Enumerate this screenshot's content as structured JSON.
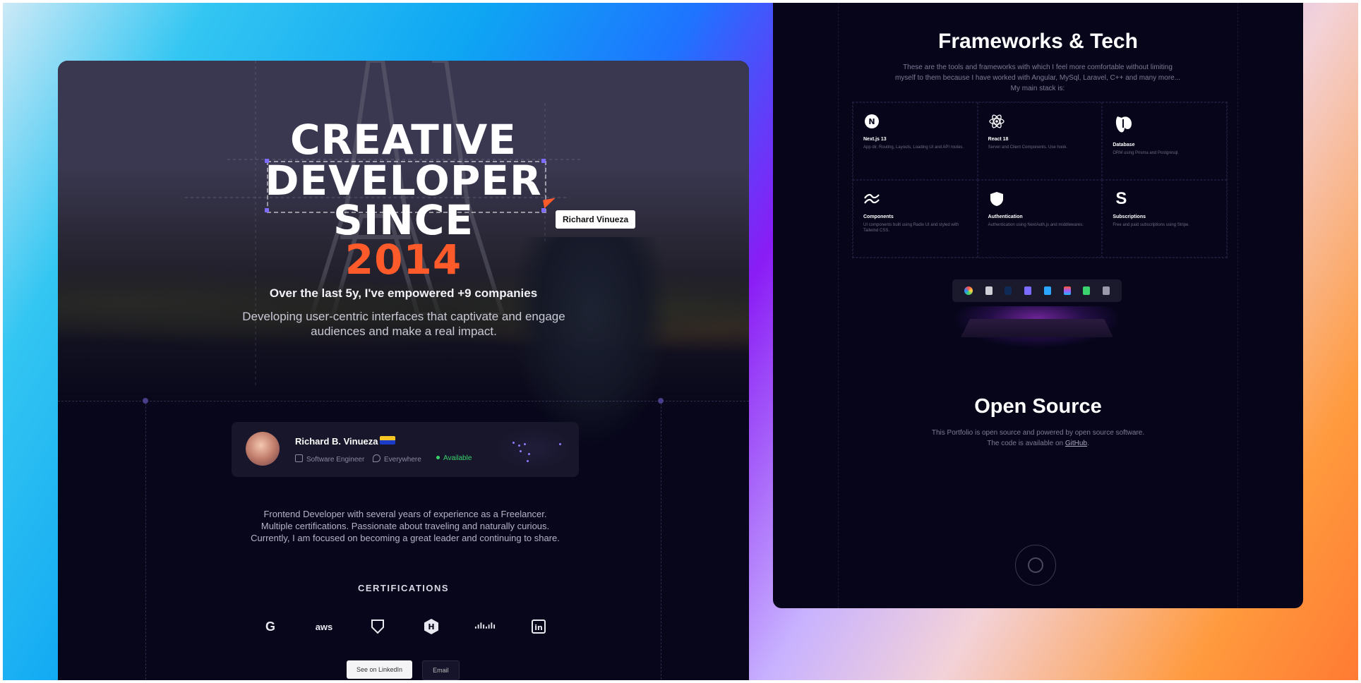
{
  "hero": {
    "title_line1": "CREATIVE",
    "title_line2": "DEVELOPER",
    "title_line3": "SINCE",
    "title_year": "2014",
    "cursor_label": "Richard Vinueza",
    "subtitle": "Over the last 5y, I've empowered +9 companies",
    "tagline": "Developing user-centric interfaces that captivate and engage audiences and make a real impact."
  },
  "profile": {
    "name": "Richard B. Vinueza",
    "role": "Software Engineer",
    "location": "Everywhere",
    "status": "Available"
  },
  "bio": "Frontend Developer with several years of experience as a Freelancer. Multiple certifications. Passionate about traveling and naturally curious. Currently, I am focused on becoming a great leader and continuing to share.",
  "certifications": {
    "title": "CERTIFICATIONS",
    "items": [
      {
        "icon": "google-icon"
      },
      {
        "icon": "aws-icon"
      },
      {
        "icon": "shield-badge-icon"
      },
      {
        "icon": "hackerrank-icon"
      },
      {
        "icon": "cisco-icon"
      },
      {
        "icon": "linkedin-icon"
      }
    ]
  },
  "buttons": {
    "linkedin": "See on LinkedIn",
    "email": "Email"
  },
  "frameworks": {
    "title": "Frameworks & Tech",
    "description": "These are the tools and frameworks with which I feel more comfortable without limiting myself to them because I have worked with Angular, MySql, Laravel, C++ and many more... My main stack is:",
    "cards": [
      {
        "icon": "nextjs-icon",
        "title": "Next.js 13",
        "desc": "App dir, Routing, Layouts, Loading UI and API routes."
      },
      {
        "icon": "react-icon",
        "title": "React 18",
        "desc": "Server and Client Components. Use hook."
      },
      {
        "icon": "database-icon",
        "title": "Database",
        "desc": "ORM using Prisma and Postgresql."
      },
      {
        "icon": "components-icon",
        "title": "Components",
        "desc": "UI components built using Radix UI and styled with Tailwind CSS."
      },
      {
        "icon": "auth-shield-icon",
        "title": "Authentication",
        "desc": "Authentication using NextAuth.js and middlewares."
      },
      {
        "icon": "stripe-icon",
        "title": "Subscriptions",
        "desc": "Free and paid subscriptions using Stripe."
      }
    ]
  },
  "open_source": {
    "title": "Open Source",
    "line1": "This Portfolio is open source and powered by open source software.",
    "line2_prefix": "The code is available on ",
    "line2_link": "GitHub",
    "line2_suffix": "."
  },
  "colors": {
    "accent_orange": "#ff5a2a",
    "panel_bg": "#07061a",
    "available_green": "#3ad36d"
  }
}
